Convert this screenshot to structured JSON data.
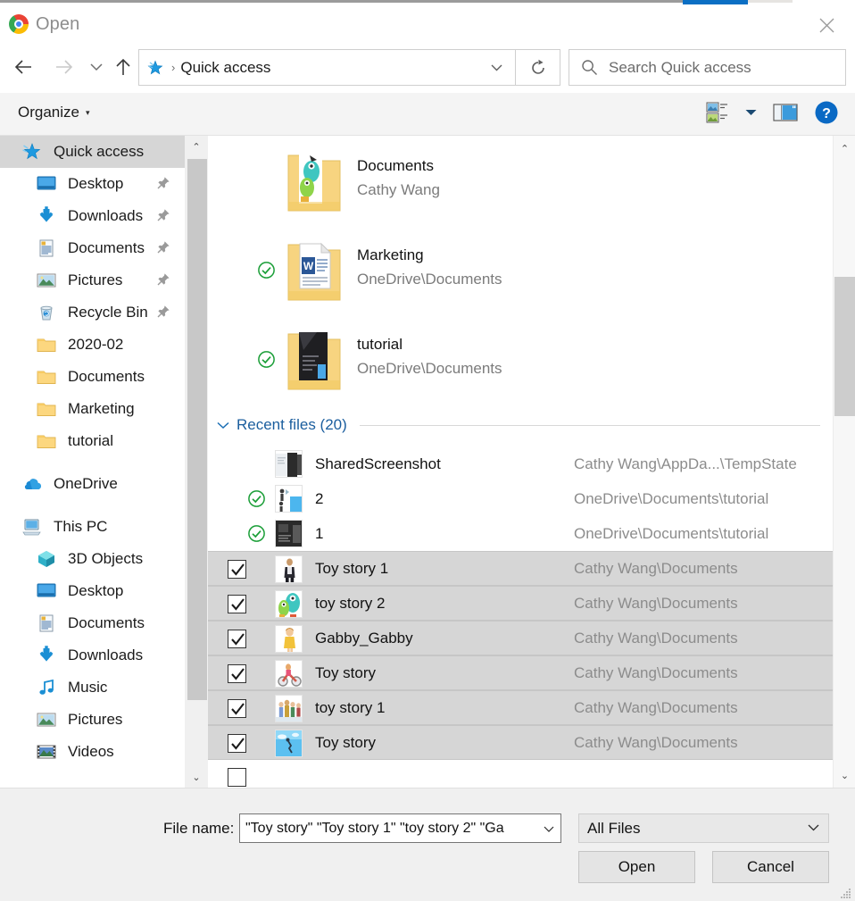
{
  "window": {
    "title": "Open",
    "app_icon": "chrome-logo",
    "close_label": "✕"
  },
  "nav": {
    "back_label": "←",
    "forward_label": "→",
    "history_label": "⌄",
    "up_label": "↑",
    "address_icon": "quick-access-star-icon",
    "address_separator": "›",
    "address_text": "Quick access",
    "address_dropdown_label": "⌄",
    "refresh_label": "↻",
    "search_placeholder": "Search Quick access",
    "search_value": ""
  },
  "commandbar": {
    "organize_label": "Organize",
    "organize_caret": "▾",
    "view_icon": "view-layout-icon",
    "view_caret": "▾",
    "pane_icon": "preview-pane-icon",
    "help_icon": "help-icon",
    "help_glyph": "?"
  },
  "sidebar": {
    "items": [
      {
        "label": "Quick access",
        "icon": "quick-access-star-icon",
        "indent": 0,
        "selected": true,
        "pinned": false
      },
      {
        "label": "Desktop",
        "icon": "desktop-icon",
        "indent": 1,
        "selected": false,
        "pinned": true
      },
      {
        "label": "Downloads",
        "icon": "downloads-icon",
        "indent": 1,
        "selected": false,
        "pinned": true
      },
      {
        "label": "Documents",
        "icon": "documents-icon",
        "indent": 1,
        "selected": false,
        "pinned": true
      },
      {
        "label": "Pictures",
        "icon": "pictures-icon",
        "indent": 1,
        "selected": false,
        "pinned": true
      },
      {
        "label": "Recycle Bin",
        "icon": "recycle-bin-icon",
        "indent": 1,
        "selected": false,
        "pinned": true
      },
      {
        "label": "2020-02",
        "icon": "folder-icon",
        "indent": 1,
        "selected": false,
        "pinned": false
      },
      {
        "label": "Documents",
        "icon": "folder-icon",
        "indent": 1,
        "selected": false,
        "pinned": false
      },
      {
        "label": "Marketing",
        "icon": "folder-icon",
        "indent": 1,
        "selected": false,
        "pinned": false
      },
      {
        "label": "tutorial",
        "icon": "folder-icon",
        "indent": 1,
        "selected": false,
        "pinned": false
      },
      {
        "label": "",
        "icon": "spacer",
        "indent": 0,
        "selected": false,
        "pinned": false
      },
      {
        "label": "OneDrive",
        "icon": "onedrive-icon",
        "indent": 0,
        "selected": false,
        "pinned": false
      },
      {
        "label": "",
        "icon": "spacer",
        "indent": 0,
        "selected": false,
        "pinned": false
      },
      {
        "label": "This PC",
        "icon": "this-pc-icon",
        "indent": 0,
        "selected": false,
        "pinned": false
      },
      {
        "label": "3D Objects",
        "icon": "3d-objects-icon",
        "indent": 1,
        "selected": false,
        "pinned": false
      },
      {
        "label": "Desktop",
        "icon": "desktop-icon",
        "indent": 1,
        "selected": false,
        "pinned": false
      },
      {
        "label": "Documents",
        "icon": "documents-icon",
        "indent": 1,
        "selected": false,
        "pinned": false
      },
      {
        "label": "Downloads",
        "icon": "downloads-icon",
        "indent": 1,
        "selected": false,
        "pinned": false
      },
      {
        "label": "Music",
        "icon": "music-icon",
        "indent": 1,
        "selected": false,
        "pinned": false
      },
      {
        "label": "Pictures",
        "icon": "pictures-icon",
        "indent": 1,
        "selected": false,
        "pinned": false
      },
      {
        "label": "Videos",
        "icon": "videos-icon",
        "indent": 1,
        "selected": false,
        "pinned": false
      }
    ],
    "scroll_up": "⌃",
    "scroll_down": "⌄"
  },
  "main": {
    "folders": [
      {
        "name": "Documents",
        "sub": "Cathy Wang",
        "sync": false,
        "thumb": "toy-figure-thumb"
      },
      {
        "name": "Marketing",
        "sub": "OneDrive\\Documents",
        "sync": true,
        "thumb": "word-doc-thumb"
      },
      {
        "name": "tutorial",
        "sub": "OneDrive\\Documents",
        "sync": true,
        "thumb": "dark-doc-thumb"
      }
    ],
    "recent_section": {
      "caret": "⌄",
      "title": "Recent files (20)"
    },
    "files": [
      {
        "name": "SharedScreenshot",
        "path": "Cathy Wang\\AppDa...\\TempState",
        "checked": false,
        "sync": false,
        "thumb": "screenshot-thumb"
      },
      {
        "name": "2",
        "path": "OneDrive\\Documents\\tutorial",
        "checked": false,
        "sync": true,
        "thumb": "people-thumb"
      },
      {
        "name": "1",
        "path": "OneDrive\\Documents\\tutorial",
        "checked": false,
        "sync": true,
        "thumb": "dark-screen-thumb"
      },
      {
        "name": "Toy story 1",
        "path": "Cathy Wang\\Documents",
        "checked": true,
        "sync": false,
        "thumb": "figure-dark-thumb"
      },
      {
        "name": "toy story 2",
        "path": "Cathy Wang\\Documents",
        "checked": true,
        "sync": false,
        "thumb": "green-monster-thumb"
      },
      {
        "name": "Gabby_Gabby",
        "path": "Cathy Wang\\Documents",
        "checked": true,
        "sync": false,
        "thumb": "gabby-doll-thumb"
      },
      {
        "name": "Toy story",
        "path": "Cathy Wang\\Documents",
        "checked": true,
        "sync": false,
        "thumb": "scooter-thumb"
      },
      {
        "name": "toy story 1",
        "path": "Cathy Wang\\Documents",
        "checked": true,
        "sync": false,
        "thumb": "group-thumb"
      },
      {
        "name": "Toy story",
        "path": "Cathy Wang\\Documents",
        "checked": true,
        "sync": false,
        "thumb": "blue-sky-thumb"
      }
    ],
    "scroll_up": "⌃",
    "scroll_down": "⌄"
  },
  "footer": {
    "filename_label": "File name:",
    "filename_value": "\"Toy story\" \"Toy story 1\" \"toy story 2\" \"Ga",
    "filename_caret": "⌄",
    "filetype_value": "All Files",
    "filetype_caret": "⌄",
    "open_label": "Open",
    "cancel_label": "Cancel"
  },
  "colors": {
    "accent_blue": "#0b6fc4",
    "selection_gray": "#d6d6d6",
    "sync_green": "#1a9e37",
    "folder_yellow": "#fcd77f",
    "link_blue": "#1b5e9e"
  }
}
